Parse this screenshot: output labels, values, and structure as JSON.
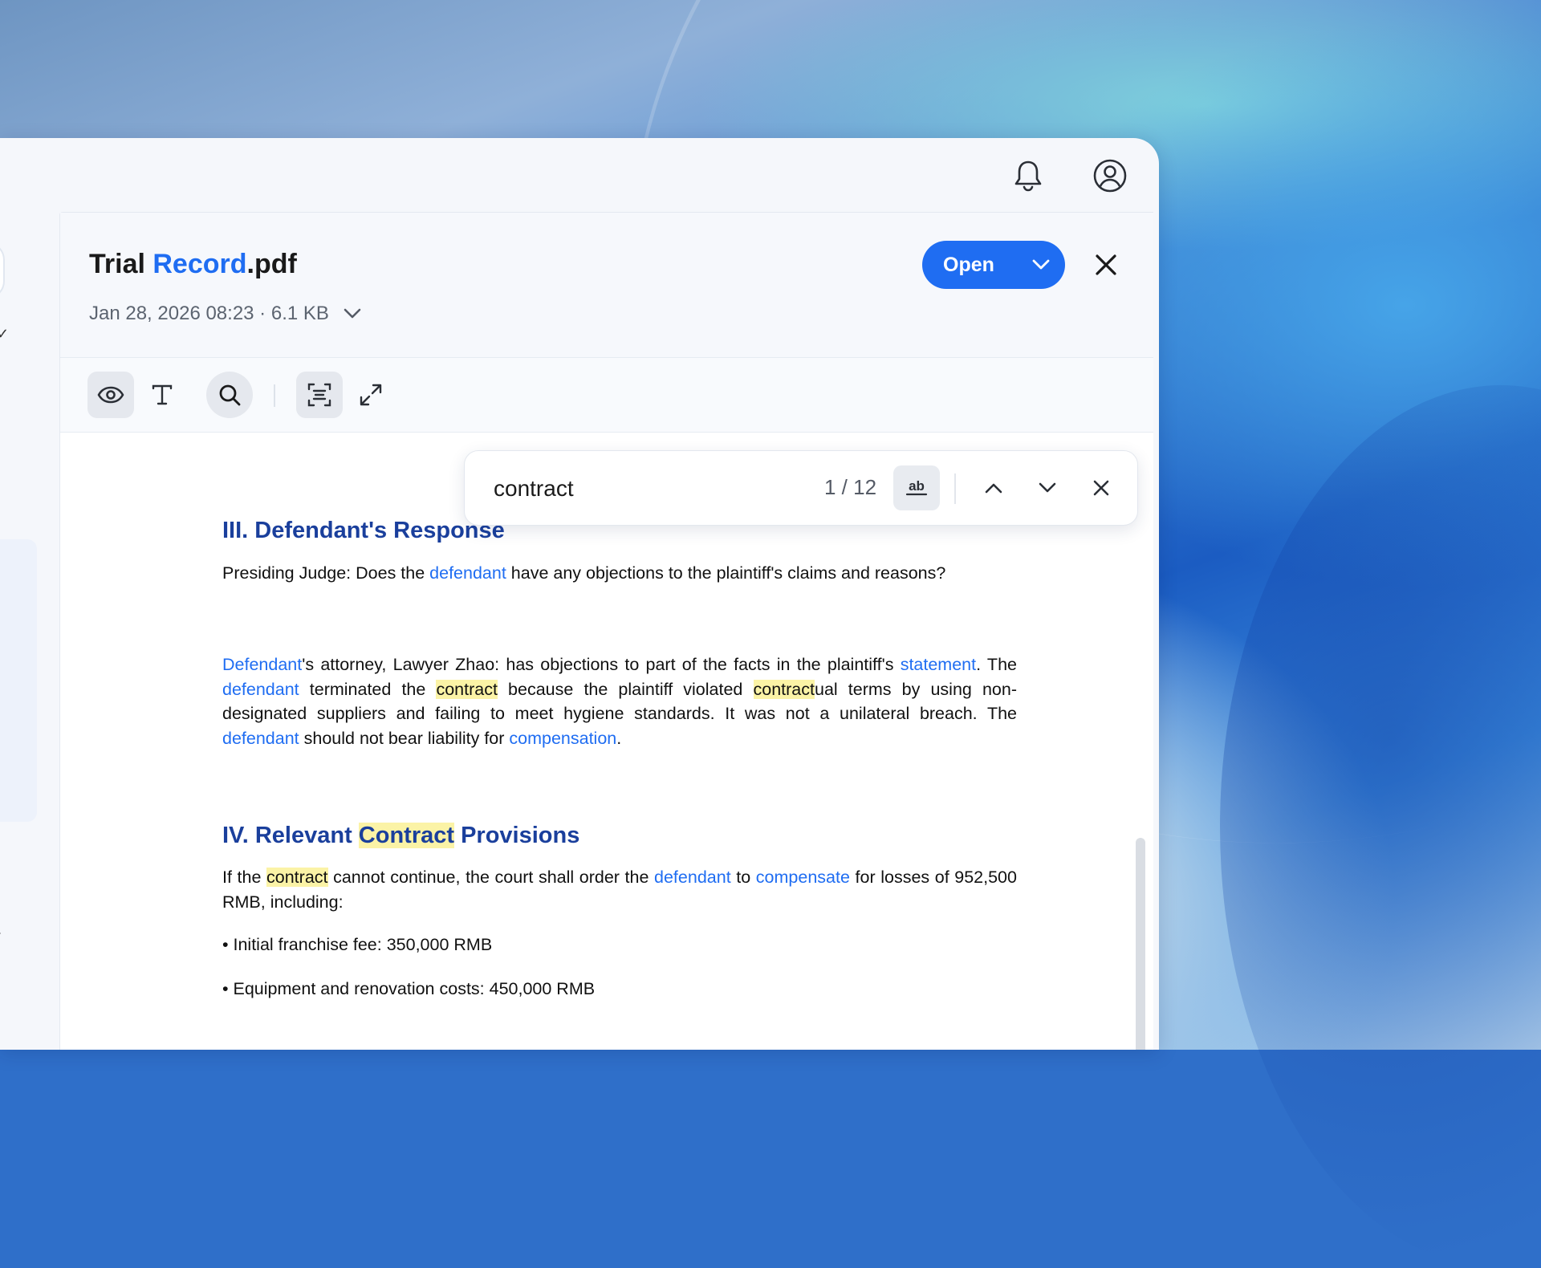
{
  "file": {
    "title_part1": "Trial ",
    "title_accent": "Record",
    "title_ext": ".pdf",
    "meta": "Jan 28, 2026 08:23 · 6.1 KB"
  },
  "actions": {
    "open_label": "Open"
  },
  "find": {
    "query": "contract",
    "count": "1 / 12",
    "match_case_label": "ab"
  },
  "document": {
    "section3": {
      "heading": "III. Defendant's Response",
      "p1": [
        "Presiding Judge: Does the ",
        "defendant",
        " have any objections to the plaintiff's claims and reasons?"
      ],
      "p2": [
        "Defendant",
        "'s attorney, Lawyer Zhao: has objections to part of the facts in the plaintiff's ",
        "statement",
        ". The ",
        "defendant",
        " terminated the ",
        "contract",
        " because the plaintiff violated ",
        "contract",
        "ual terms by using non-designated suppliers and failing to meet hygiene standards. It was not a unilateral breach. The ",
        "defendant",
        " should not bear liability for ",
        "compensation",
        "."
      ]
    },
    "section4": {
      "heading": [
        "IV. Relevant ",
        "Contract",
        " Provisions"
      ],
      "p1": [
        "If the ",
        "contract",
        " cannot continue, the court shall order the ",
        "defendant",
        " to ",
        "compensate",
        " for losses of 952,500 RMB, including:"
      ],
      "bullets": [
        "• Initial franchise fee: 350,000 RMB",
        "• Equipment and renovation costs: 450,000 RMB"
      ]
    }
  },
  "icons": {
    "bell": "bell-icon",
    "account": "user-circle-icon",
    "close": "close-icon",
    "view": "eye-icon",
    "text": "text-icon",
    "search": "search-icon",
    "ocr": "ocr-scan-icon",
    "expand": "expand-icon"
  },
  "colors": {
    "accent": "#1f6df2",
    "heading": "#1a3f9c",
    "highlight": "#fbf3a6"
  }
}
